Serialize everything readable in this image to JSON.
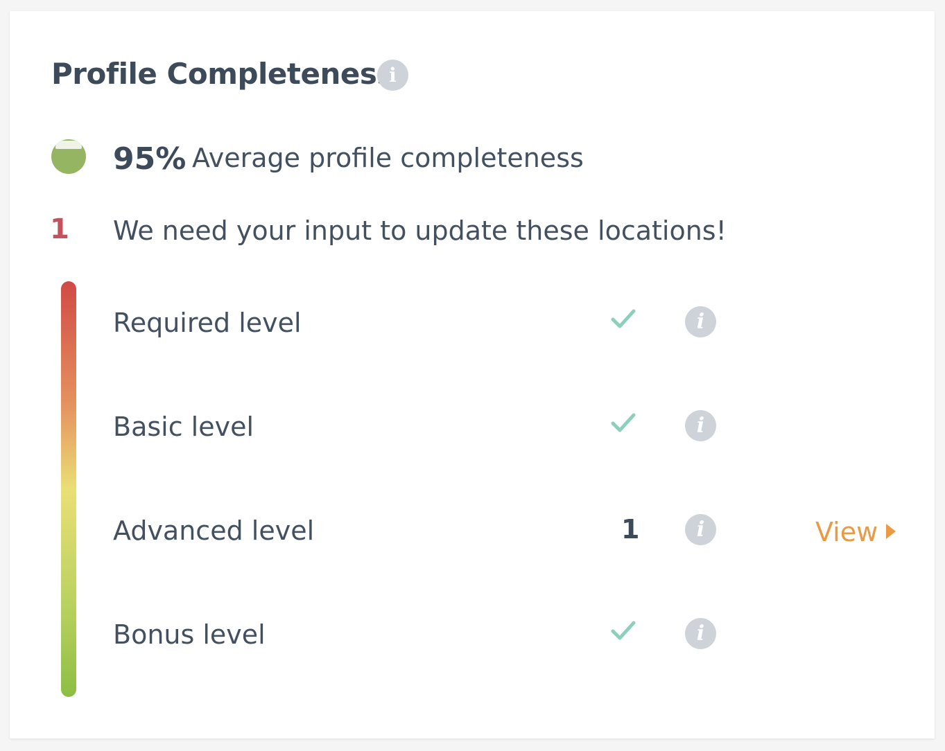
{
  "title": "Profile Completeness",
  "average": {
    "percent_text": "95%",
    "label": "Average profile completeness",
    "status_color": "#95b562"
  },
  "needs_input": {
    "count": "1",
    "text": "We need your input to update these locations!",
    "count_color": "#c4515b"
  },
  "levels": [
    {
      "label": "Required level",
      "status": "complete"
    },
    {
      "label": "Basic level",
      "status": "complete"
    },
    {
      "label": "Advanced level",
      "status": "incomplete",
      "count": "1",
      "action_label": "View"
    },
    {
      "label": "Bonus level",
      "status": "complete"
    }
  ],
  "icons": {
    "info": "info-icon",
    "check": "check-icon",
    "arrow": "caret-right-icon"
  },
  "colors": {
    "check": "#8ecfb8",
    "link": "#e89a45",
    "gradient": [
      "#d04a45",
      "#e5935f",
      "#eadf76",
      "#b9d160",
      "#8dbe44"
    ]
  }
}
